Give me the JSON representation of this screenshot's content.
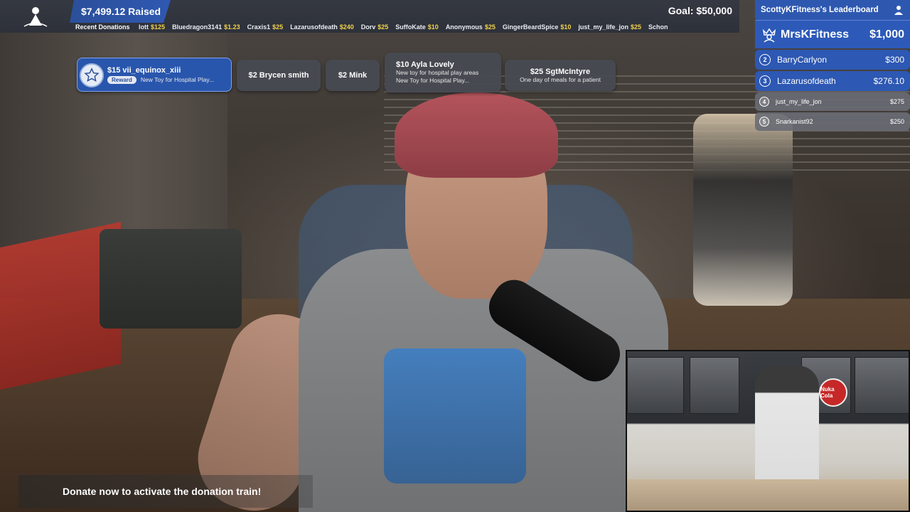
{
  "top_bar": {
    "raised": "$7,499.12 Raised",
    "goal": "Goal: $50,000",
    "ticker_label": "Recent Donations",
    "ticker": [
      {
        "name": "lott",
        "amount": "$125"
      },
      {
        "name": "Bluedragon3141",
        "amount": "$1.23"
      },
      {
        "name": "Craxis1",
        "amount": "$25"
      },
      {
        "name": "Lazarusofdeath",
        "amount": "$240"
      },
      {
        "name": "Dorv",
        "amount": "$25"
      },
      {
        "name": "SuffoKate",
        "amount": "$10"
      },
      {
        "name": "Anonymous",
        "amount": "$25"
      },
      {
        "name": "GingerBeardSpice",
        "amount": "$10"
      },
      {
        "name": "just_my_life_jon",
        "amount": "$25"
      },
      {
        "name": "Schon",
        "amount": ""
      }
    ]
  },
  "donation_cards": {
    "featured": {
      "title": "$15 vii_equinox_xiii",
      "badge": "Reward",
      "note": "New Toy for Hospital Play..."
    },
    "c2": {
      "title": "$2 Brycen smith"
    },
    "c3": {
      "title": "$2 Mink"
    },
    "c4": {
      "title": "$10 Ayla Lovely",
      "line1": "New toy for hospital play areas",
      "line2": "New Toy for Hospital Play..."
    },
    "c5": {
      "title": "$25 SgtMcIntyre",
      "line1": "One day of meals for a patient"
    }
  },
  "leaderboard": {
    "title": "ScottyKFitness's Leaderboard",
    "top": {
      "name": "MrsKFitness",
      "amount": "$1,000"
    },
    "rows": [
      {
        "rank": "2",
        "name": "BarryCarlyon",
        "amount": "$300"
      },
      {
        "rank": "3",
        "name": "Lazarusofdeath",
        "amount": "$276.10"
      },
      {
        "rank": "4",
        "name": "just_my_life_jon",
        "amount": "$275"
      },
      {
        "rank": "5",
        "name": "Snarkanist92",
        "amount": "$250"
      }
    ]
  },
  "bottom": {
    "donate_text": "Donate now to activate the donation train!"
  },
  "pip": {
    "sign_text": "Nuka Cola"
  },
  "colors": {
    "accent_blue": "#2d5ab9",
    "amount_yellow": "#f2d24b"
  },
  "icons": {
    "logo": "st-jude-figure-icon",
    "featured_badge": "star-badge-icon",
    "leaderboard_header": "person-icon",
    "leaderboard_top": "crown-user-icon"
  }
}
